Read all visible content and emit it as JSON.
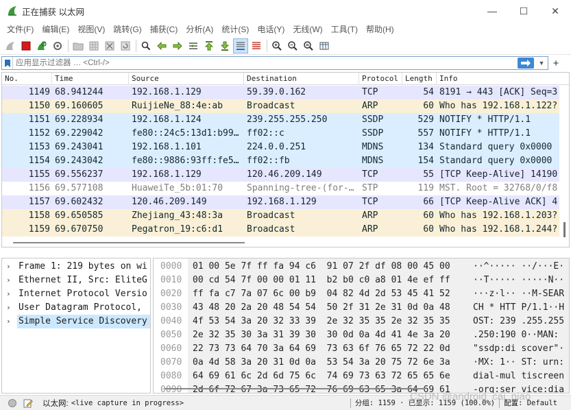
{
  "window": {
    "title": "正在捕获 以太网",
    "minimize": "—",
    "maximize": "☐",
    "close": "✕"
  },
  "menu": [
    "文件(F)",
    "编辑(E)",
    "视图(V)",
    "跳转(G)",
    "捕获(C)",
    "分析(A)",
    "统计(S)",
    "电话(Y)",
    "无线(W)",
    "工具(T)",
    "帮助(H)"
  ],
  "filter": {
    "placeholder": "应用显示过滤器 … <Ctrl-/>",
    "plus": "+"
  },
  "packet_list": {
    "columns": [
      "No.",
      "Time",
      "Source",
      "Destination",
      "Protocol",
      "Length",
      "Info"
    ],
    "rows": [
      {
        "no": "1149",
        "time": "68.941244",
        "src": "192.168.1.129",
        "dst": "59.39.0.162",
        "proto": "TCP",
        "len": "54",
        "info": "8191 → 443 [ACK] Seq=3",
        "bg": "#e7e6ff",
        "fg": "#12272e"
      },
      {
        "no": "1150",
        "time": "69.160605",
        "src": "RuijieNe_88:4e:ab",
        "dst": "Broadcast",
        "proto": "ARP",
        "len": "60",
        "info": "Who has 192.168.1.122?",
        "bg": "#faf0d7",
        "fg": "#12272e"
      },
      {
        "no": "1151",
        "time": "69.228934",
        "src": "192.168.1.124",
        "dst": "239.255.255.250",
        "proto": "SSDP",
        "len": "529",
        "info": "NOTIFY * HTTP/1.1",
        "bg": "#daeeff",
        "fg": "#12272e"
      },
      {
        "no": "1152",
        "time": "69.229042",
        "src": "fe80::24c5:13d1:b99…",
        "dst": "ff02::c",
        "proto": "SSDP",
        "len": "557",
        "info": "NOTIFY * HTTP/1.1",
        "bg": "#daeeff",
        "fg": "#12272e"
      },
      {
        "no": "1153",
        "time": "69.243041",
        "src": "192.168.1.101",
        "dst": "224.0.0.251",
        "proto": "MDNS",
        "len": "134",
        "info": "Standard query 0x0000",
        "bg": "#daeeff",
        "fg": "#12272e"
      },
      {
        "no": "1154",
        "time": "69.243042",
        "src": "fe80::9886:93ff:fe5…",
        "dst": "ff02::fb",
        "proto": "MDNS",
        "len": "154",
        "info": "Standard query 0x0000",
        "bg": "#daeeff",
        "fg": "#12272e"
      },
      {
        "no": "1155",
        "time": "69.556237",
        "src": "192.168.1.129",
        "dst": "120.46.209.149",
        "proto": "TCP",
        "len": "55",
        "info": "[TCP Keep-Alive] 14190",
        "bg": "#e7e6ff",
        "fg": "#12272e"
      },
      {
        "no": "1156",
        "time": "69.577108",
        "src": "HuaweiTe_5b:01:70",
        "dst": "Spanning-tree-(for-…",
        "proto": "STP",
        "len": "119",
        "info": "MST. Root = 32768/0/f8",
        "bg": "#ffffff",
        "fg": "#7f7f7f"
      },
      {
        "no": "1157",
        "time": "69.602432",
        "src": "120.46.209.149",
        "dst": "192.168.1.129",
        "proto": "TCP",
        "len": "66",
        "info": "[TCP Keep-Alive ACK] 4",
        "bg": "#e7e6ff",
        "fg": "#12272e"
      },
      {
        "no": "1158",
        "time": "69.650585",
        "src": "Zhejiang_43:48:3a",
        "dst": "Broadcast",
        "proto": "ARP",
        "len": "60",
        "info": "Who has 192.168.1.203?",
        "bg": "#faf0d7",
        "fg": "#12272e"
      },
      {
        "no": "1159",
        "time": "69.670750",
        "src": "Pegatron_19:c6:d1",
        "dst": "Broadcast",
        "proto": "ARP",
        "len": "60",
        "info": "Who has 192.168.1.244?",
        "bg": "#faf0d7",
        "fg": "#12272e"
      }
    ]
  },
  "details": [
    {
      "label": "Frame 1: 219 bytes on wi",
      "expander": "›"
    },
    {
      "label": "Ethernet II, Src: EliteG",
      "expander": "›"
    },
    {
      "label": "Internet Protocol Versio",
      "expander": "›"
    },
    {
      "label": "User Datagram Protocol,",
      "expander": "›"
    },
    {
      "label": "Simple Service Discovery",
      "expander": "›",
      "selected": true
    }
  ],
  "bytes": [
    {
      "off": "0000",
      "hex": "01 00 5e 7f ff fa 94 c6  91 07 2f df 08 00 45 00",
      "ascii": "··^····· ··/···E·"
    },
    {
      "off": "0010",
      "hex": "00 cd 54 7f 00 00 01 11  b2 b0 c0 a8 01 4e ef ff",
      "ascii": "··T····· ·····N··"
    },
    {
      "off": "0020",
      "hex": "ff fa c7 7a 07 6c 00 b9  04 82 4d 2d 53 45 41 52",
      "ascii": "···z·l·· ··M-SEAR"
    },
    {
      "off": "0030",
      "hex": "43 48 20 2a 20 48 54 54  50 2f 31 2e 31 0d 0a 48",
      "ascii": "CH * HTT P/1.1··H"
    },
    {
      "off": "0040",
      "hex": "4f 53 54 3a 20 32 33 39  2e 32 35 35 2e 32 35 35",
      "ascii": "OST: 239 .255.255"
    },
    {
      "off": "0050",
      "hex": "2e 32 35 30 3a 31 39 30  30 0d 0a 4d 41 4e 3a 20",
      "ascii": ".250:190 0··MAN: "
    },
    {
      "off": "0060",
      "hex": "22 73 73 64 70 3a 64 69  73 63 6f 76 65 72 22 0d",
      "ascii": "\"ssdp:di scover\"·"
    },
    {
      "off": "0070",
      "hex": "0a 4d 58 3a 20 31 0d 0a  53 54 3a 20 75 72 6e 3a",
      "ascii": "·MX: 1·· ST: urn:"
    },
    {
      "off": "0080",
      "hex": "64 69 61 6c 2d 6d 75 6c  74 69 73 63 72 65 65 6e",
      "ascii": "dial-mul tiscreen"
    },
    {
      "off": "0090",
      "hex": "2d 6f 72 67 3a 73 65 72  76 69 63 65 3a 64 69 61",
      "ascii": "-org:ser vice:dia"
    }
  ],
  "status": {
    "interface": "以太网:",
    "capture": "<live capture in progress>",
    "groups": "分组: 1159 · 已显示: 1159 (100.0%)",
    "profile": "配置: Default"
  },
  "watermark": "CSDN @android_cai_niao",
  "colors": {
    "accent": "#3f88d3",
    "selection": "#cce8ff"
  }
}
